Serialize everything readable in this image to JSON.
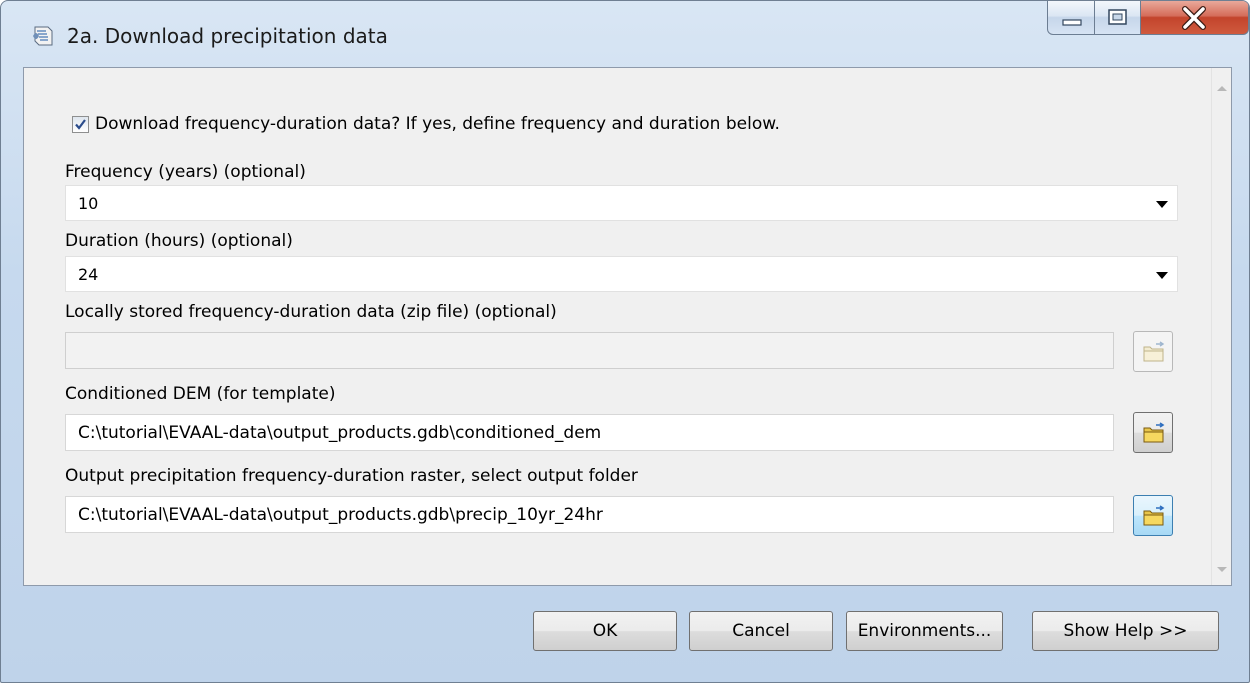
{
  "window": {
    "title": "2a. Download precipitation data",
    "icon": "script-tool-icon",
    "controls": [
      "minimize-icon",
      "maximize-icon",
      "close-icon"
    ]
  },
  "form": {
    "download_checkbox": {
      "checked": true,
      "label": "Download frequency-duration data? If yes, define frequency and duration below."
    },
    "frequency": {
      "label": "Frequency (years) (optional)",
      "value": "10"
    },
    "duration": {
      "label": "Duration (hours) (optional)",
      "value": "24"
    },
    "local_zip": {
      "label": "Locally stored frequency-duration data (zip file) (optional)",
      "value": ""
    },
    "conditioned_dem": {
      "label": "Conditioned DEM (for template)",
      "value": "C:\\tutorial\\EVAAL-data\\output_products.gdb\\conditioned_dem"
    },
    "output_raster": {
      "label": "Output precipitation frequency-duration raster, select output folder",
      "value": "C:\\tutorial\\EVAAL-data\\output_products.gdb\\precip_10yr_24hr"
    }
  },
  "buttons": {
    "ok": "OK",
    "cancel": "Cancel",
    "environments": "Environments...",
    "show_help": "Show Help >>"
  }
}
